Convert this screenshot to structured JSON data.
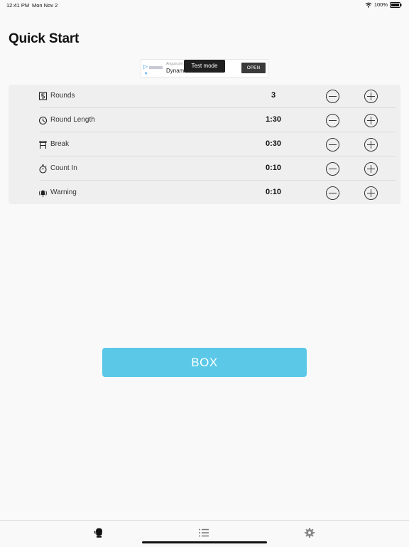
{
  "status_bar": {
    "time": "12:41 PM",
    "date": "Mon Nov 2",
    "battery": "100%",
    "icons": [
      "wifi-icon",
      "battery-icon"
    ]
  },
  "page": {
    "title": "Quick Start"
  },
  "ad": {
    "advertiser": "Anguscom",
    "headline": "Dynam          s",
    "test_mode": "Test mode",
    "open_label": "OPEN"
  },
  "settings": [
    {
      "icon": "rounds-icon",
      "label": "Rounds",
      "value": "3"
    },
    {
      "icon": "clock-icon",
      "label": "Round Length",
      "value": "1:30"
    },
    {
      "icon": "stool-icon",
      "label": "Break",
      "value": "0:30"
    },
    {
      "icon": "stopwatch-icon",
      "label": "Count In",
      "value": "0:10"
    },
    {
      "icon": "warning-bell-icon",
      "label": "Warning",
      "value": "0:10"
    }
  ],
  "actions": {
    "box_label": "BOX"
  },
  "tab_bar": {
    "tabs": [
      "boxing-glove-icon",
      "list-icon",
      "gear-icon"
    ]
  },
  "colors": {
    "accent": "#5bc8e8",
    "background": "#f9f9f9",
    "card": "#efeff0"
  }
}
